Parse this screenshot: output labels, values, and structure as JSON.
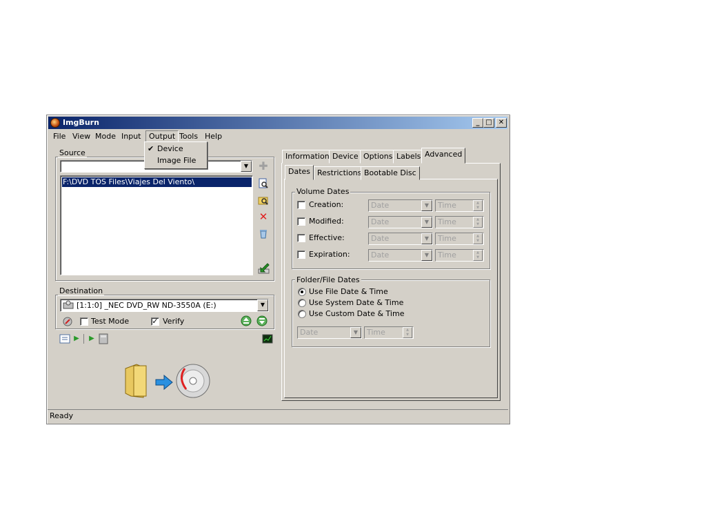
{
  "window": {
    "title": "ImgBurn"
  },
  "menu": {
    "items": [
      "File",
      "View",
      "Mode",
      "Input",
      "Output",
      "Tools",
      "Help"
    ],
    "output_popup": {
      "device": "Device",
      "image_file": "Image File",
      "checked": "Device"
    }
  },
  "source": {
    "label": "Source",
    "combo_value": "",
    "list_items": [
      "F:\\DVD TOS Files\\Viajes Del Viento\\"
    ]
  },
  "destination": {
    "label": "Destination",
    "drive": "[1:1:0] _NEC DVD_RW ND-3550A (E:)",
    "test_mode_label": "Test Mode",
    "test_mode_checked": false,
    "verify_label": "Verify",
    "verify_checked": true
  },
  "tabs": {
    "main": [
      "Information",
      "Device",
      "Options",
      "Labels",
      "Advanced"
    ],
    "main_active": "Advanced",
    "sub": [
      "Dates",
      "Restrictions",
      "Bootable Disc"
    ],
    "sub_active": "Dates"
  },
  "volume_dates": {
    "label": "Volume Dates",
    "rows": [
      {
        "label": "Creation:",
        "date_placeholder": "Date",
        "time_placeholder": "Time"
      },
      {
        "label": "Modified:",
        "date_placeholder": "Date",
        "time_placeholder": "Time"
      },
      {
        "label": "Effective:",
        "date_placeholder": "Date",
        "time_placeholder": "Time"
      },
      {
        "label": "Expiration:",
        "date_placeholder": "Date",
        "time_placeholder": "Time"
      }
    ]
  },
  "folder_file_dates": {
    "label": "Folder/File Dates",
    "options": [
      "Use File Date & Time",
      "Use System Date & Time",
      "Use Custom Date & Time"
    ],
    "selected": "Use File Date & Time",
    "date_placeholder": "Date",
    "time_placeholder": "Time"
  },
  "status": {
    "text": "Ready"
  },
  "icons": {
    "add": "plus-icon",
    "browse_file": "browse-file-icon",
    "browse_folder": "browse-folder-icon",
    "remove": "red-x-icon",
    "clear": "trash-icon",
    "build": "build-green-arrow-icon",
    "colors": {
      "title_start": "#0a246a",
      "title_end": "#a6caf0",
      "selection": "#0a246a",
      "remove_red": "#e02020",
      "green": "#2a9a2a"
    }
  }
}
